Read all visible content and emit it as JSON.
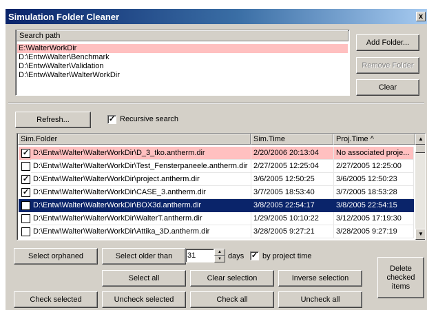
{
  "window": {
    "title": "Simulation Folder Cleaner",
    "close_glyph": "x"
  },
  "search": {
    "header": "Search path",
    "paths": [
      "E:\\WalterWorkDir",
      "D:\\Entw\\Walter\\Benchmark",
      "D:\\Entw\\Walter\\Validation",
      "D:\\Entw\\Walter\\WalterWorkDir"
    ],
    "add_folder": "Add Folder...",
    "remove_folder": "Remove Folder",
    "clear": "Clear"
  },
  "toolbar": {
    "refresh": "Refresh...",
    "recursive_label": "Recursive search",
    "recursive_checked": "✓"
  },
  "grid": {
    "columns": [
      "Sim.Folder",
      "Sim.Time",
      "Proj.Time ^"
    ],
    "rows": [
      {
        "checked": "✓",
        "folder": "D:\\Entw\\Walter\\WalterWorkDir\\D_3_tko.antherm.dir",
        "sim_time": "2/20/2006 20:13:04",
        "proj_time": "No associated proje..."
      },
      {
        "checked": "",
        "folder": "D:\\Entw\\Walter\\WalterWorkDir\\Test_Fensterpaneele.antherm.dir",
        "sim_time": "2/27/2005 12:25:04",
        "proj_time": "2/27/2005 12:25:00"
      },
      {
        "checked": "✓",
        "folder": "D:\\Entw\\Walter\\WalterWorkDir\\project.antherm.dir",
        "sim_time": "3/6/2005 12:50:25",
        "proj_time": "3/6/2005 12:50:23"
      },
      {
        "checked": "✓",
        "folder": "D:\\Entw\\Walter\\WalterWorkDir\\CASE_3.antherm.dir",
        "sim_time": "3/7/2005 18:53:40",
        "proj_time": "3/7/2005 18:53:28"
      },
      {
        "checked": "",
        "folder": "D:\\Entw\\Walter\\WalterWorkDir\\BOX3d.antherm.dir",
        "sim_time": "3/8/2005 22:54:17",
        "proj_time": "3/8/2005 22:54:15"
      },
      {
        "checked": "",
        "folder": "D:\\Entw\\Walter\\WalterWorkDir\\WalterT.antherm.dir",
        "sim_time": "1/29/2005 10:10:22",
        "proj_time": "3/12/2005 17:19:30"
      },
      {
        "checked": "",
        "folder": "D:\\Entw\\Walter\\WalterWorkDir\\Attika_3D.antherm.dir",
        "sim_time": "3/28/2005 9:27:21",
        "proj_time": "3/28/2005 9:27:19"
      }
    ]
  },
  "actions": {
    "select_orphaned": "Select orphaned",
    "select_older_than": "Select older than",
    "days_value": "31",
    "days_label": "days",
    "by_project_time_label": "by project time",
    "by_project_time_checked": "✓",
    "select_all": "Select all",
    "clear_selection": "Clear selection",
    "inverse_selection": "Inverse selection",
    "check_selected": "Check selected",
    "uncheck_selected": "Uncheck selected",
    "check_all": "Check all",
    "uncheck_all": "Uncheck all",
    "delete_checked_items": "Delete checked items"
  },
  "colors": {
    "selection": "#0a246a",
    "orphan_highlight": "#ffc0c0",
    "face": "#d4d0c8"
  }
}
